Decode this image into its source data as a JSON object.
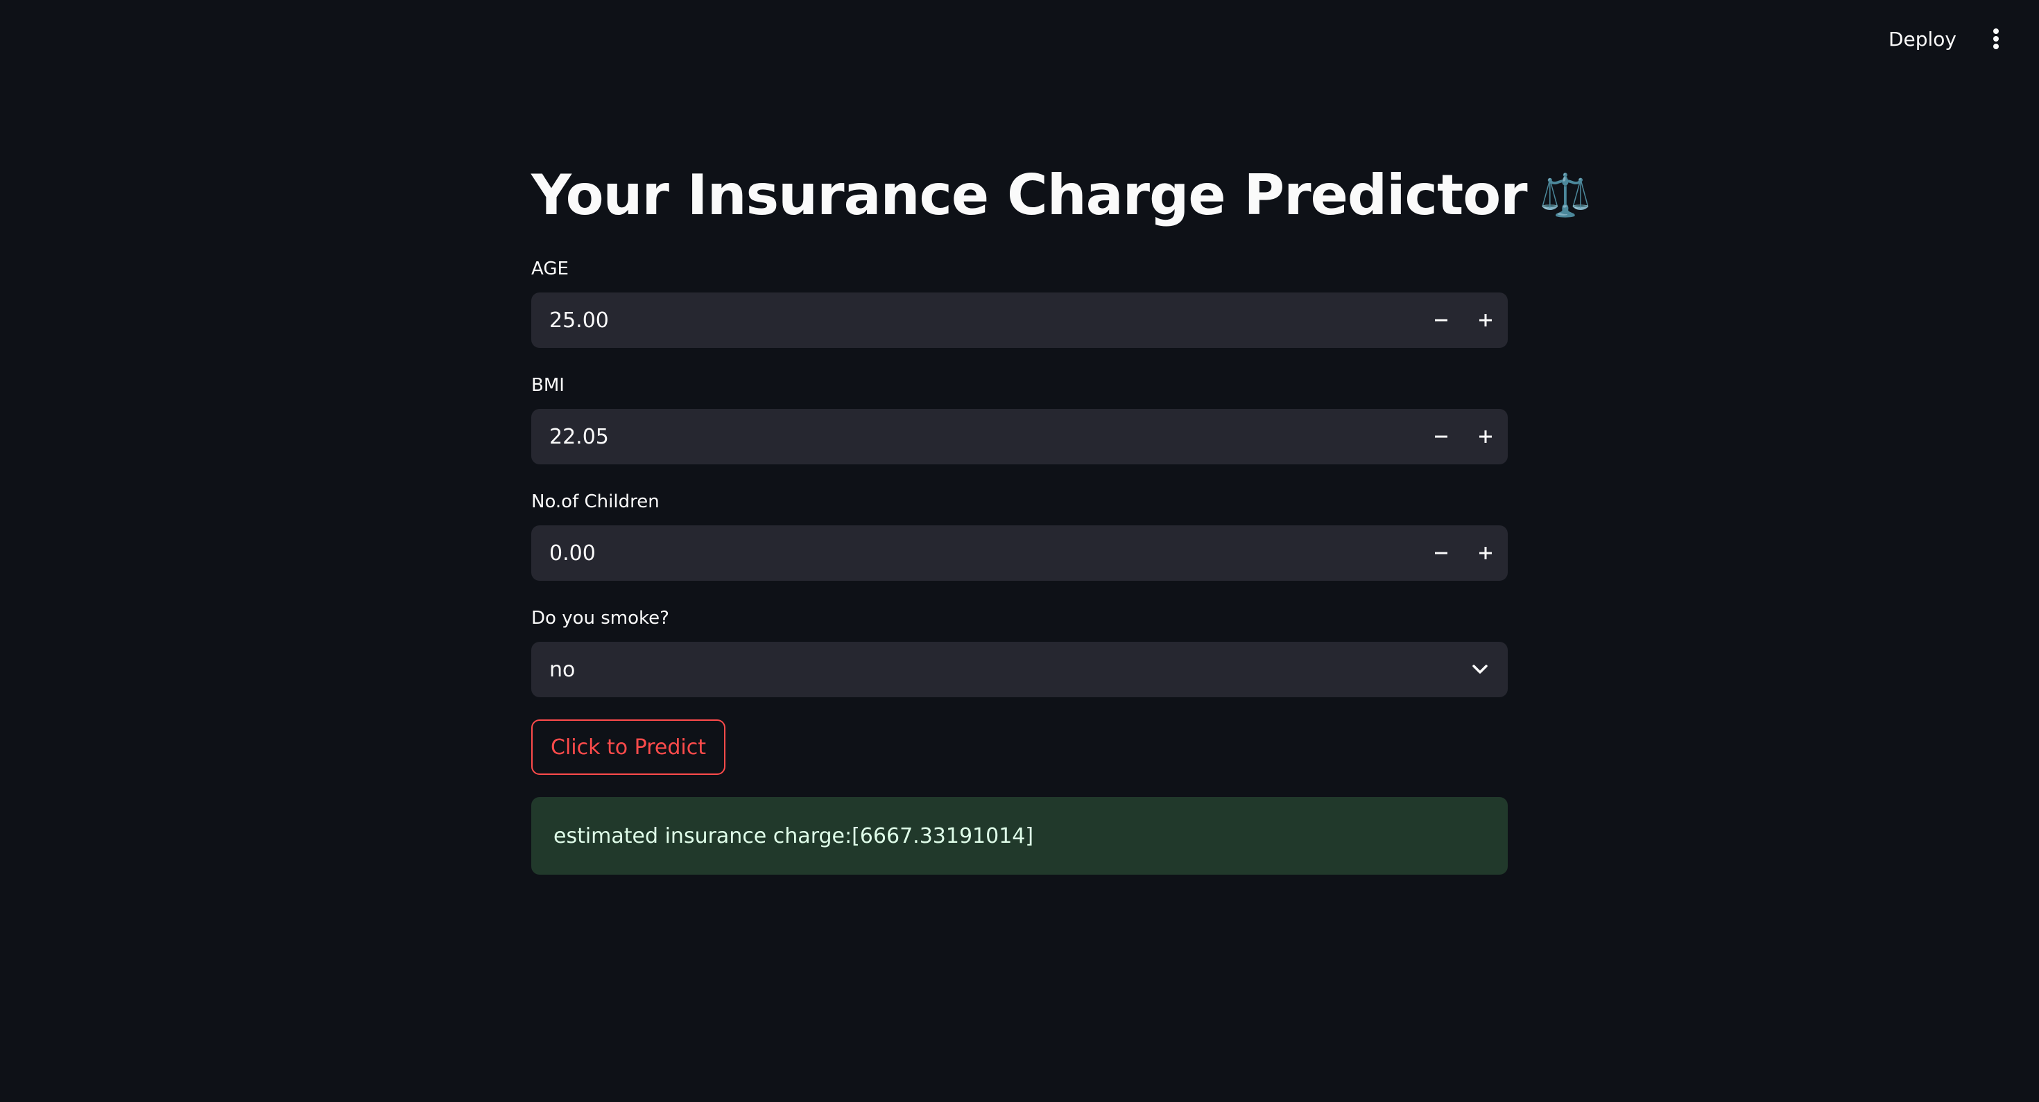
{
  "header": {
    "deploy_label": "Deploy",
    "menu_icon": "vertical-dots-icon"
  },
  "main": {
    "title": "Your Insurance Charge Predictor",
    "title_emoji": "⚖️",
    "age": {
      "label": "AGE",
      "value": "25.00"
    },
    "bmi": {
      "label": "BMI",
      "value": "22.05"
    },
    "children": {
      "label": "No.of Children",
      "value": "0.00"
    },
    "smoker": {
      "label": "Do you smoke?",
      "selected": "no"
    },
    "predict_label": "Click to Predict",
    "result_text": "estimated insurance charge:[6667.33191014]"
  },
  "colors": {
    "background": "#0e1117",
    "input_bg": "#262730",
    "accent": "#ff4b4b",
    "success_bg": "#21392b"
  }
}
